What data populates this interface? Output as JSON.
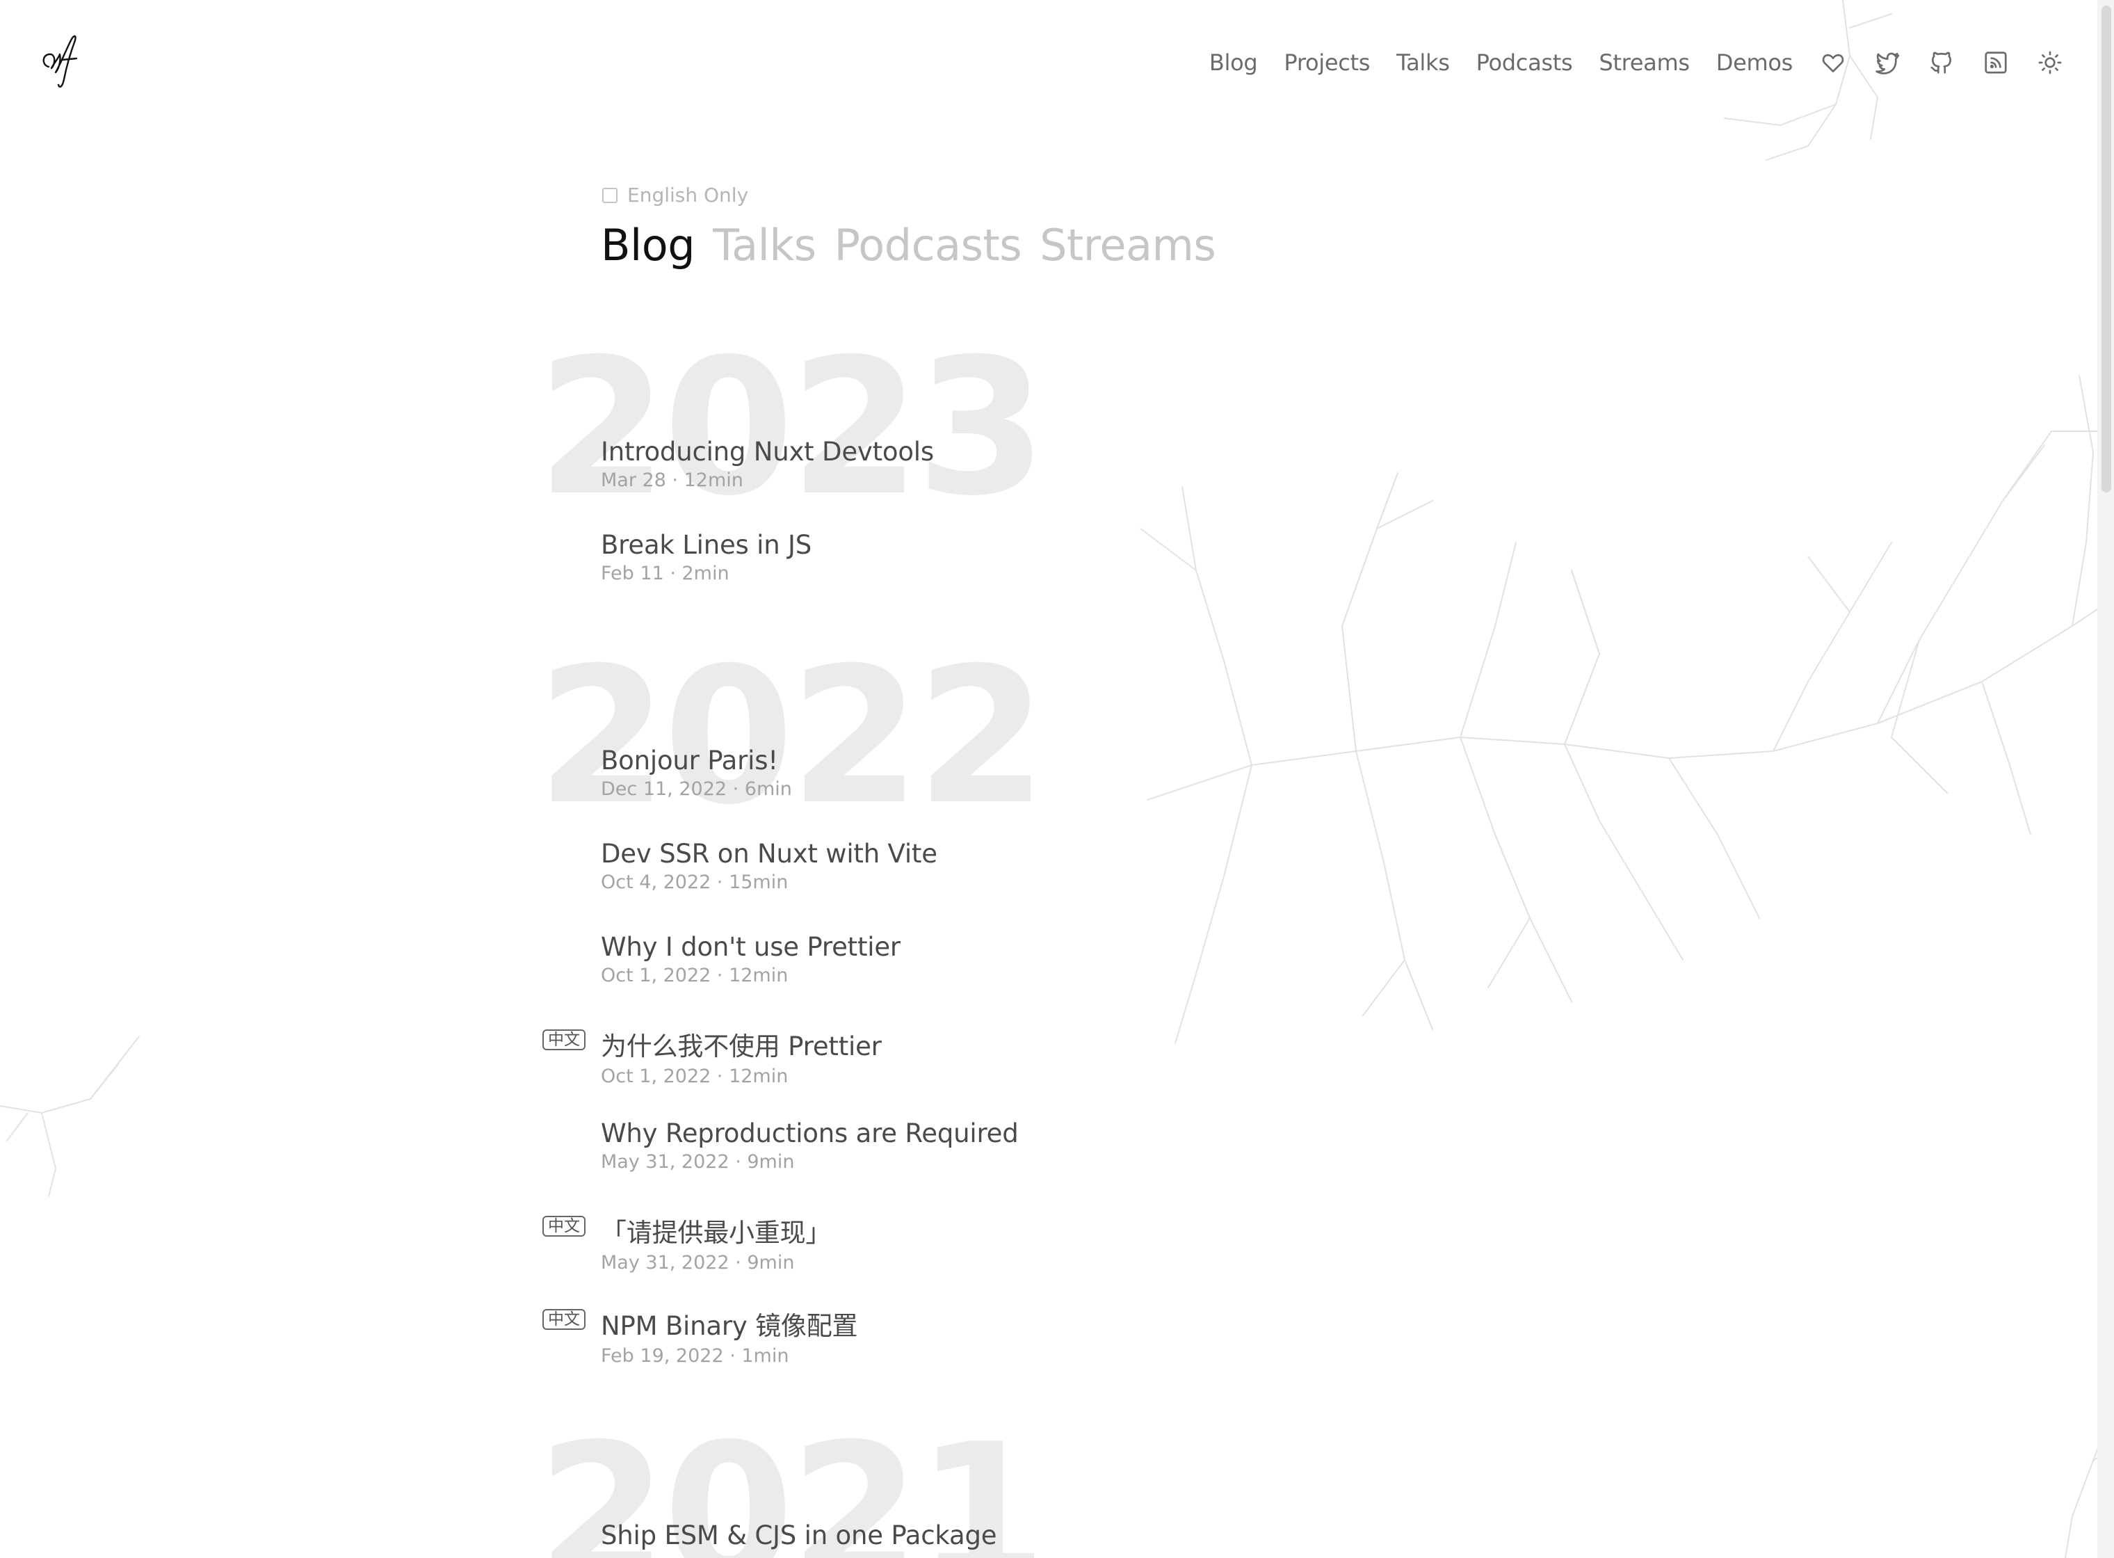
{
  "header": {
    "nav": [
      {
        "label": "Blog"
      },
      {
        "label": "Projects"
      },
      {
        "label": "Talks"
      },
      {
        "label": "Podcasts"
      },
      {
        "label": "Streams"
      },
      {
        "label": "Demos"
      }
    ],
    "icons": [
      "heart-icon",
      "twitter-icon",
      "github-icon",
      "rss-icon",
      "sun-icon"
    ]
  },
  "filter": {
    "label": "English Only",
    "checked": false
  },
  "tabs": [
    {
      "label": "Blog",
      "active": true
    },
    {
      "label": "Talks",
      "active": false
    },
    {
      "label": "Podcasts",
      "active": false
    },
    {
      "label": "Streams",
      "active": false
    }
  ],
  "years": [
    {
      "year": "2023",
      "posts": [
        {
          "title": "Introducing Nuxt Devtools",
          "meta": "Mar 28 · 12min",
          "badge": ""
        },
        {
          "title": "Break Lines in JS",
          "meta": "Feb 11 · 2min",
          "badge": ""
        }
      ]
    },
    {
      "year": "2022",
      "posts": [
        {
          "title": "Bonjour Paris!",
          "meta": "Dec 11, 2022 · 6min",
          "badge": ""
        },
        {
          "title": "Dev SSR on Nuxt with Vite",
          "meta": "Oct 4, 2022 · 15min",
          "badge": ""
        },
        {
          "title": "Why I don't use Prettier",
          "meta": "Oct 1, 2022 · 12min",
          "badge": ""
        },
        {
          "title": "为什么我不使用 Prettier",
          "meta": "Oct 1, 2022 · 12min",
          "badge": "中文"
        },
        {
          "title": "Why Reproductions are Required",
          "meta": "May 31, 2022 · 9min",
          "badge": ""
        },
        {
          "title": "「请提供最小重现」",
          "meta": "May 31, 2022 · 9min",
          "badge": "中文"
        },
        {
          "title": "NPM Binary 镜像配置",
          "meta": "Feb 19, 2022 · 1min",
          "badge": "中文"
        }
      ]
    },
    {
      "year": "2021",
      "posts": [
        {
          "title": "Ship ESM & CJS in one Package",
          "meta": "",
          "badge": ""
        }
      ]
    }
  ]
}
